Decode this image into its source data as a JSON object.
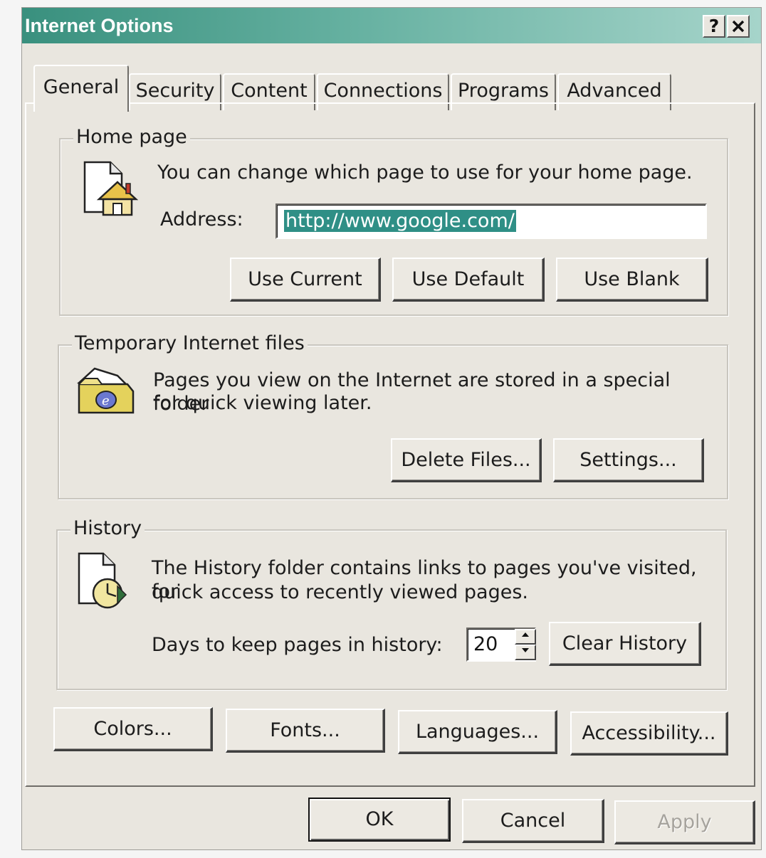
{
  "window": {
    "title": "Internet Options",
    "help_label": "?",
    "close_label": "✕"
  },
  "tabs": [
    {
      "label": "General",
      "active": true
    },
    {
      "label": "Security",
      "active": false
    },
    {
      "label": "Content",
      "active": false
    },
    {
      "label": "Connections",
      "active": false
    },
    {
      "label": "Programs",
      "active": false
    },
    {
      "label": "Advanced",
      "active": false
    }
  ],
  "home_page": {
    "legend": "Home page",
    "description": "You can change which page to use for your home page.",
    "address_label": "Address:",
    "address_value": "http://www.google.com/",
    "icon": "home-page-icon",
    "buttons": {
      "use_current": "Use Current",
      "use_default": "Use Default",
      "use_blank": "Use Blank"
    }
  },
  "temp_files": {
    "legend": "Temporary Internet files",
    "description_line1": "Pages you view on the Internet are stored in a special folder",
    "description_line2": "for quick viewing later.",
    "icon": "temporary-files-folder-icon",
    "buttons": {
      "delete_files": "Delete Files...",
      "settings": "Settings..."
    }
  },
  "history": {
    "legend": "History",
    "description_line1": "The History folder contains links to pages you've visited, for",
    "description_line2": "quick access to recently viewed pages.",
    "days_label": "Days to keep pages in history:",
    "days_value": "20",
    "icon": "history-icon",
    "clear_button": "Clear History"
  },
  "bottom_buttons": {
    "colors": "Colors...",
    "fonts": "Fonts...",
    "languages": "Languages...",
    "accessibility": "Accessibility..."
  },
  "dialog_buttons": {
    "ok": "OK",
    "cancel": "Cancel",
    "apply": "Apply"
  },
  "colors": {
    "title_bar_start": "#39907e",
    "title_bar_end": "#a6d4ca",
    "dialog_face": "#e9e6df",
    "selection": "#2f8f86"
  }
}
